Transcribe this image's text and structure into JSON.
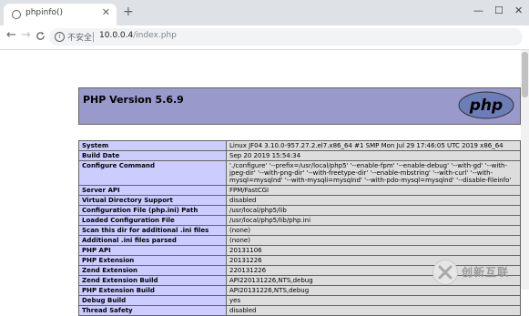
{
  "tab": {
    "title": "phpinfo()",
    "close": "✕",
    "new_tab": "+"
  },
  "window": {
    "minimize": "—",
    "maximize": "☐",
    "close": "✕"
  },
  "nav": {
    "back": "←",
    "forward": "→",
    "reload": "C"
  },
  "address": {
    "security_icon": "i",
    "security_label": "不安全",
    "host": "10.0.0.4",
    "path": "/index.php"
  },
  "page": {
    "title": "PHP Version 5.6.9",
    "logo_text": "php"
  },
  "rows": [
    {
      "key": "System",
      "value": "Linux JF04 3.10.0-957.27.2.el7.x86_64 #1 SMP Mon Jul 29 17:46:05 UTC 2019 x86_64"
    },
    {
      "key": "Build Date",
      "value": "Sep 20 2019 15:54:34"
    },
    {
      "key": "Configure Command",
      "value": "'./configure' '--prefix=/usr/local/php5' '--enable-fpm' '--enable-debug' '--with-gd' '--with-jpeg-dir' '--with-png-dir' '--with-freetype-dir' '--enable-mbstring' '--with-curl' '--with-mysql=mysqlnd' '--with-mysqli=mysqlnd' '--with-pdo-mysql=mysqlnd' '--disable-fileinfo'"
    },
    {
      "key": "Server API",
      "value": "FPM/FastCGI"
    },
    {
      "key": "Virtual Directory Support",
      "value": "disabled"
    },
    {
      "key": "Configuration File (php.ini) Path",
      "value": "/usr/local/php5/lib"
    },
    {
      "key": "Loaded Configuration File",
      "value": "/usr/local/php5/lib/php.ini"
    },
    {
      "key": "Scan this dir for additional .ini files",
      "value": "(none)"
    },
    {
      "key": "Additional .ini files parsed",
      "value": "(none)"
    },
    {
      "key": "PHP API",
      "value": "20131106"
    },
    {
      "key": "PHP Extension",
      "value": "20131226"
    },
    {
      "key": "Zend Extension",
      "value": "220131226"
    },
    {
      "key": "Zend Extension Build",
      "value": "API220131226,NTS,debug"
    },
    {
      "key": "PHP Extension Build",
      "value": "API20131226,NTS,debug"
    },
    {
      "key": "Debug Build",
      "value": "yes"
    },
    {
      "key": "Thread Safety",
      "value": "disabled"
    }
  ],
  "watermark": {
    "text": "创新互联",
    "mark": "X"
  },
  "colors": {
    "header_bg": "#9999cc",
    "key_bg": "#ccccff",
    "value_bg": "#dddddd",
    "border": "#666666"
  }
}
